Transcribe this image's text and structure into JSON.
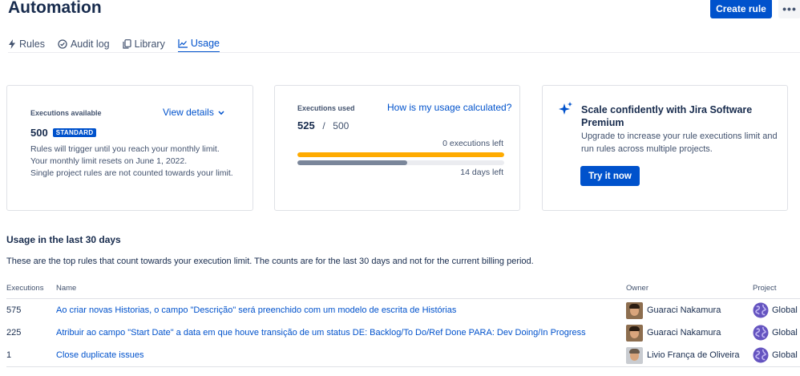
{
  "header": {
    "title": "Automation",
    "create_rule": "Create rule",
    "more": "•••"
  },
  "tabs": [
    {
      "label": "Rules",
      "icon": "lightning-icon"
    },
    {
      "label": "Audit log",
      "icon": "check-circle-icon"
    },
    {
      "label": "Library",
      "icon": "copy-icon"
    },
    {
      "label": "Usage",
      "icon": "chart-icon",
      "active": true
    }
  ],
  "card_available": {
    "label": "Executions available",
    "view_details": "View details",
    "count": "500",
    "tier": "STANDARD",
    "lines": [
      "Rules will trigger until you reach your monthly limit.",
      "Your monthly limit resets on June 1, 2022.",
      "Single project rules are not counted towards your limit."
    ]
  },
  "card_used": {
    "label": "Executions used",
    "help_link": "How is my usage calculated?",
    "used": "525",
    "separator": "/",
    "limit": "500",
    "executions_left": "0 executions left",
    "days_left": "14 days left",
    "usage_fraction": 1.0,
    "time_fraction": 0.53
  },
  "card_upgrade": {
    "title": "Scale confidently with Jira Software Premium",
    "text": "Upgrade to increase your rule executions limit and run rules across multiple projects.",
    "button": "Try it now"
  },
  "usage": {
    "title": "Usage in the last 30 days",
    "description": "These are the top rules that count towards your execution limit. The counts are for the last 30 days and not for the current billing period.",
    "columns": {
      "executions": "Executions",
      "name": "Name",
      "owner": "Owner",
      "project": "Project"
    },
    "rows": [
      {
        "executions": "575",
        "name": "Ao criar novas Historias, o campo \"Descrição\" será preenchido com um modelo de escrita de Histórias",
        "owner": "Guaraci Nakamura",
        "project": "Global"
      },
      {
        "executions": "225",
        "name": "Atribuir ao campo \"Start Date\" a data em que houve transição de um status DE: Backlog/To Do/Ref Done PARA: Dev Doing/In Progress",
        "owner": "Guaraci Nakamura",
        "project": "Global"
      },
      {
        "executions": "1",
        "name": "Close duplicate issues",
        "owner": "Livio França de Oliveira",
        "project": "Global"
      }
    ]
  },
  "colors": {
    "brand": "#0052cc",
    "warning": "#ffab00",
    "neutral_bar": "#7a869a"
  }
}
